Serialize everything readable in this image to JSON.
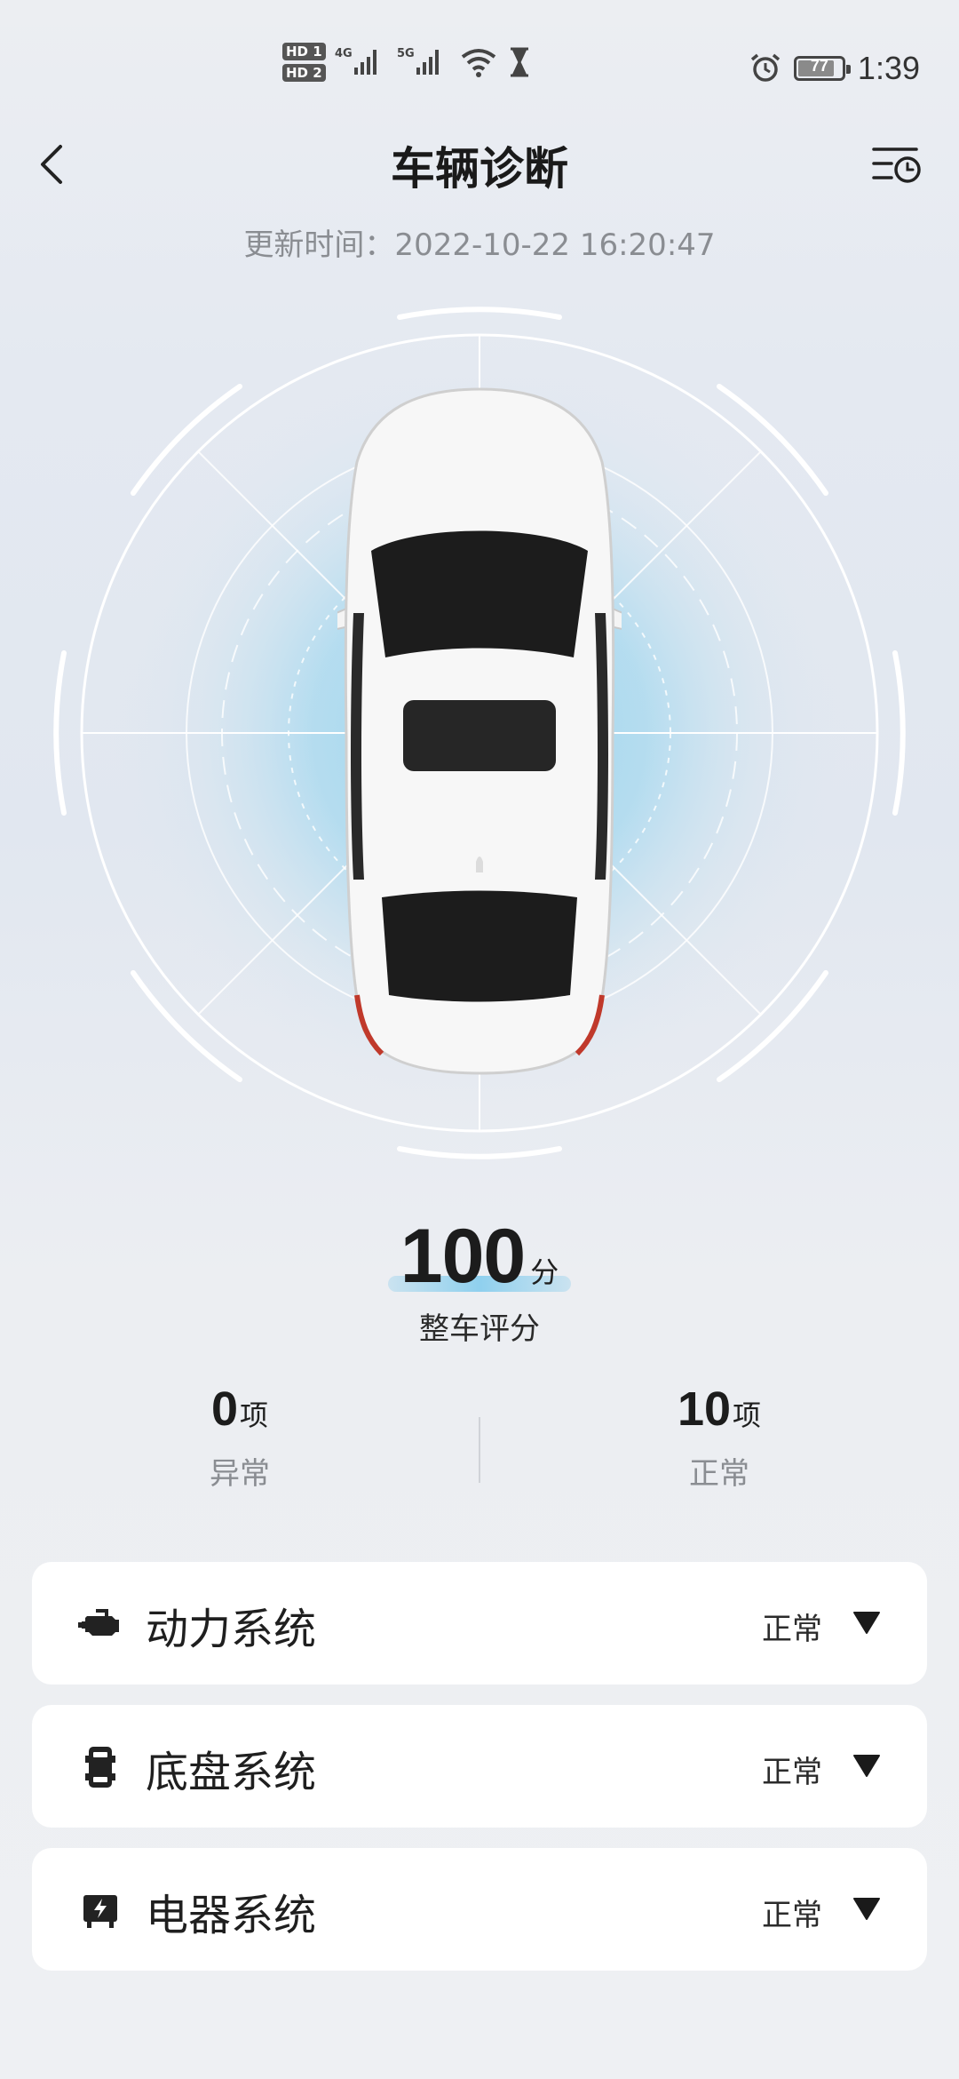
{
  "status_bar": {
    "hd1": "HD 1",
    "hd2": "HD 2",
    "net1": "4G",
    "net2": "5G",
    "battery_level": "77",
    "time": "1:39",
    "icons": [
      "signal-icon",
      "wifi-icon",
      "hourglass-icon",
      "alarm-icon",
      "battery-icon"
    ]
  },
  "header": {
    "title": "车辆诊断",
    "update_time": "更新时间：2022-10-22 16:20:47"
  },
  "score": {
    "value": "100",
    "unit": "分",
    "label": "整车评分"
  },
  "counts": {
    "abnormal": {
      "value": "0",
      "unit": "项",
      "label": "异常"
    },
    "normal": {
      "value": "10",
      "unit": "项",
      "label": "正常"
    }
  },
  "systems": [
    {
      "name": "动力系统",
      "status": "正常",
      "icon": "engine-icon"
    },
    {
      "name": "底盘系统",
      "status": "正常",
      "icon": "chassis-icon"
    },
    {
      "name": "电器系统",
      "status": "正常",
      "icon": "electrical-icon"
    }
  ],
  "colors": {
    "glow": "#8fd0ee",
    "card_bg": "#ffffff",
    "muted_text": "#8a8d92"
  }
}
